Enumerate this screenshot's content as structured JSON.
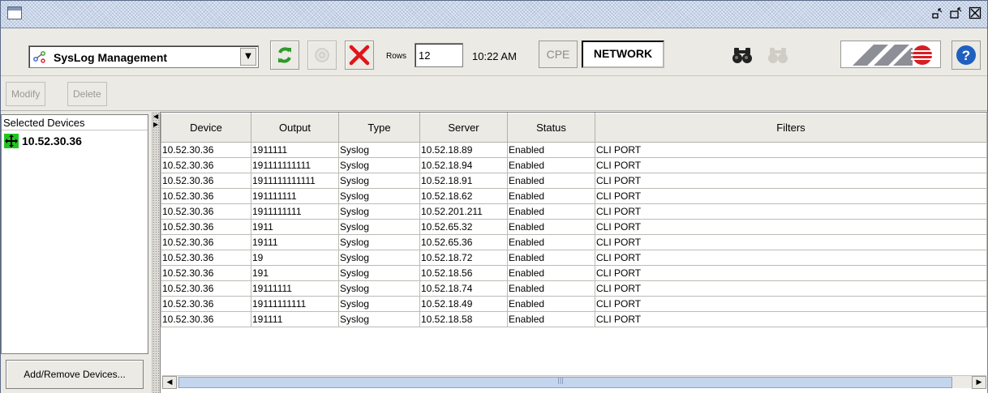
{
  "titlebar": {
    "system_icon": "window-icon",
    "controls": [
      "restore-icon",
      "maximize-icon",
      "close-icon"
    ]
  },
  "toolbar": {
    "module_select": {
      "value": "SysLog Management",
      "icon": "syslog-icon"
    },
    "buttons": [
      "refresh-icon",
      "stop-icon",
      "cancel-icon"
    ],
    "rows_label": "Rows",
    "rows_value": "12",
    "clock": "10:22 AM",
    "cpe_label": "CPE",
    "network_label": "NETWORK",
    "find_icon": "binoculars-icon",
    "find_next_icon": "binoculars-disabled-icon",
    "logo": "allied-telesyn-logo",
    "help_icon": "help-icon"
  },
  "actions": {
    "modify_label": "Modify",
    "delete_label": "Delete"
  },
  "left_panel": {
    "header": "Selected Devices",
    "devices": [
      {
        "label": "10.52.30.36",
        "icon": "device-icon"
      }
    ],
    "add_remove_label": "Add/Remove Devices..."
  },
  "table": {
    "columns": [
      "Device",
      "Output",
      "Type",
      "Server",
      "Status",
      "Filters"
    ],
    "rows": [
      [
        "10.52.30.36",
        "1911111",
        "Syslog",
        "10.52.18.89",
        "Enabled",
        "CLI PORT"
      ],
      [
        "10.52.30.36",
        "191111111111",
        "Syslog",
        "10.52.18.94",
        "Enabled",
        "CLI PORT"
      ],
      [
        "10.52.30.36",
        "1911111111111",
        "Syslog",
        "10.52.18.91",
        "Enabled",
        "CLI PORT"
      ],
      [
        "10.52.30.36",
        "191111111",
        "Syslog",
        "10.52.18.62",
        "Enabled",
        "CLI PORT"
      ],
      [
        "10.52.30.36",
        "1911111111",
        "Syslog",
        "10.52.201.211",
        "Enabled",
        "CLI PORT"
      ],
      [
        "10.52.30.36",
        "1911",
        "Syslog",
        "10.52.65.32",
        "Enabled",
        "CLI PORT"
      ],
      [
        "10.52.30.36",
        "19111",
        "Syslog",
        "10.52.65.36",
        "Enabled",
        "CLI PORT"
      ],
      [
        "10.52.30.36",
        "19",
        "Syslog",
        "10.52.18.72",
        "Enabled",
        "CLI PORT"
      ],
      [
        "10.52.30.36",
        "191",
        "Syslog",
        "10.52.18.56",
        "Enabled",
        "CLI PORT"
      ],
      [
        "10.52.30.36",
        "19111111",
        "Syslog",
        "10.52.18.74",
        "Enabled",
        "CLI PORT"
      ],
      [
        "10.52.30.36",
        "19111111111",
        "Syslog",
        "10.52.18.49",
        "Enabled",
        "CLI PORT"
      ],
      [
        "10.52.30.36",
        "191111",
        "Syslog",
        "10.52.18.58",
        "Enabled",
        "CLI PORT"
      ]
    ]
  },
  "colors": {
    "refresh": "#2f9a2a",
    "cancel": "#e0151b",
    "help": "#1f5fbf",
    "logo_red": "#d81e23",
    "scroll_thumb": "#c4d5ee"
  }
}
